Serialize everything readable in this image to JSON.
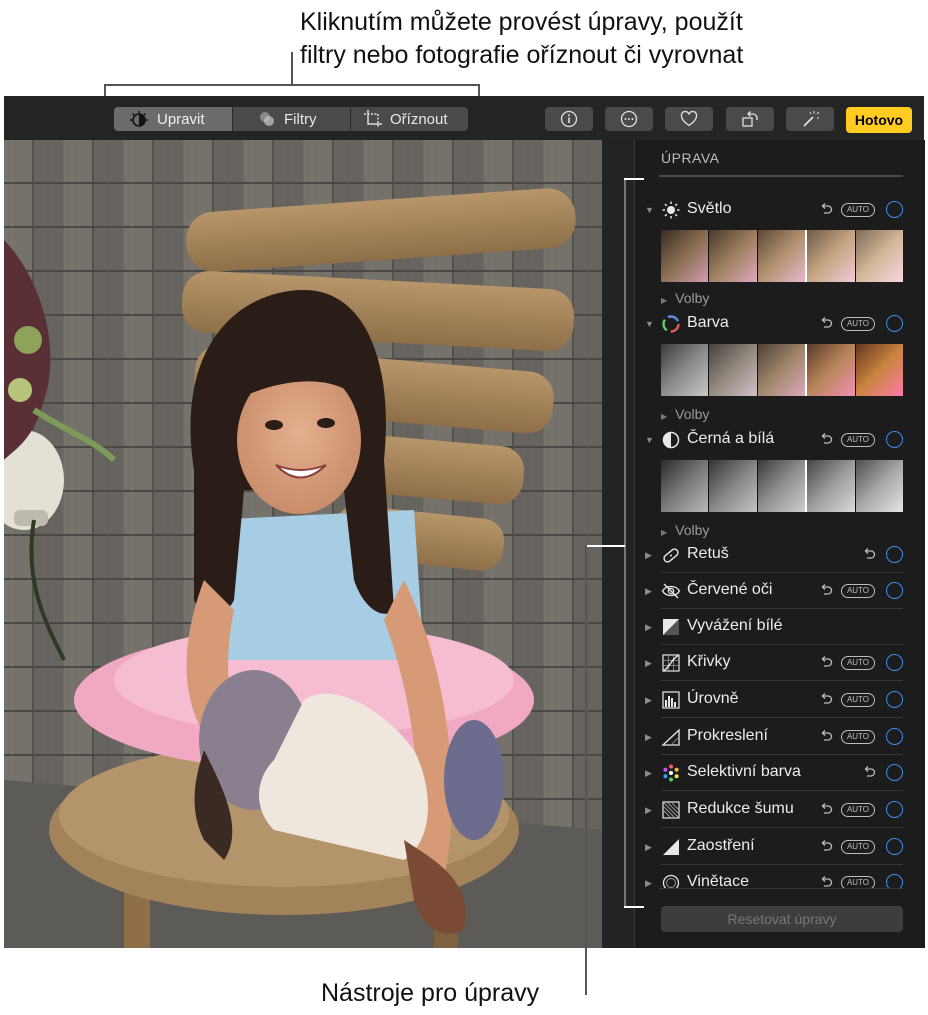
{
  "callouts": {
    "top_line1": "Kliknutím můžete provést úpravy, použít",
    "top_line2": "filtry nebo fotografie oříznout či vyrovnat",
    "bottom": "Nástroje pro úpravy"
  },
  "toolbar": {
    "tabs": [
      {
        "label": "Upravit",
        "icon": "adjust-icon",
        "active": true
      },
      {
        "label": "Filtry",
        "icon": "filters-icon",
        "active": false
      },
      {
        "label": "Oříznout",
        "icon": "crop-icon",
        "active": false
      }
    ],
    "buttons": [
      {
        "icon": "info-icon"
      },
      {
        "icon": "more-icon"
      },
      {
        "icon": "heart-icon"
      },
      {
        "icon": "rotate-icon"
      },
      {
        "icon": "magic-wand-icon"
      }
    ],
    "done_label": "Hotovo",
    "accent_color": "#ffcc1f"
  },
  "panel": {
    "title": "ÚPRAVA",
    "adjustments": [
      {
        "label": "Světlo",
        "icon": "sun-icon",
        "expanded": true,
        "auto": "AUTO",
        "options": "Volby"
      },
      {
        "label": "Barva",
        "icon": "color-wheel-icon",
        "expanded": true,
        "auto": "AUTO",
        "options": "Volby"
      },
      {
        "label": "Černá a bílá",
        "icon": "half-circle-icon",
        "expanded": true,
        "auto": "AUTO",
        "options": "Volby"
      },
      {
        "label": "Retuš",
        "icon": "bandage-icon",
        "expanded": false,
        "auto": null
      },
      {
        "label": "Červené oči",
        "icon": "eye-icon",
        "expanded": false,
        "auto": "AUTO"
      },
      {
        "label": "Vyvážení bílé",
        "icon": "white-balance-icon",
        "expanded": false,
        "auto": null
      },
      {
        "label": "Křivky",
        "icon": "curves-icon",
        "expanded": false,
        "auto": "AUTO"
      },
      {
        "label": "Úrovně",
        "icon": "levels-icon",
        "expanded": false,
        "auto": "AUTO"
      },
      {
        "label": "Prokreslení",
        "icon": "definition-icon",
        "expanded": false,
        "auto": "AUTO"
      },
      {
        "label": "Selektivní barva",
        "icon": "selective-color-icon",
        "expanded": false,
        "auto": null
      },
      {
        "label": "Redukce šumu",
        "icon": "noise-reduction-icon",
        "expanded": false,
        "auto": "AUTO"
      },
      {
        "label": "Zaostření",
        "icon": "sharpen-icon",
        "expanded": false,
        "auto": "AUTO"
      },
      {
        "label": "Vinětace",
        "icon": "vignette-icon",
        "expanded": false,
        "auto": "AUTO"
      }
    ],
    "reset_label": "Resetovat úpravy",
    "toggle_color": "#3a8cf0"
  }
}
